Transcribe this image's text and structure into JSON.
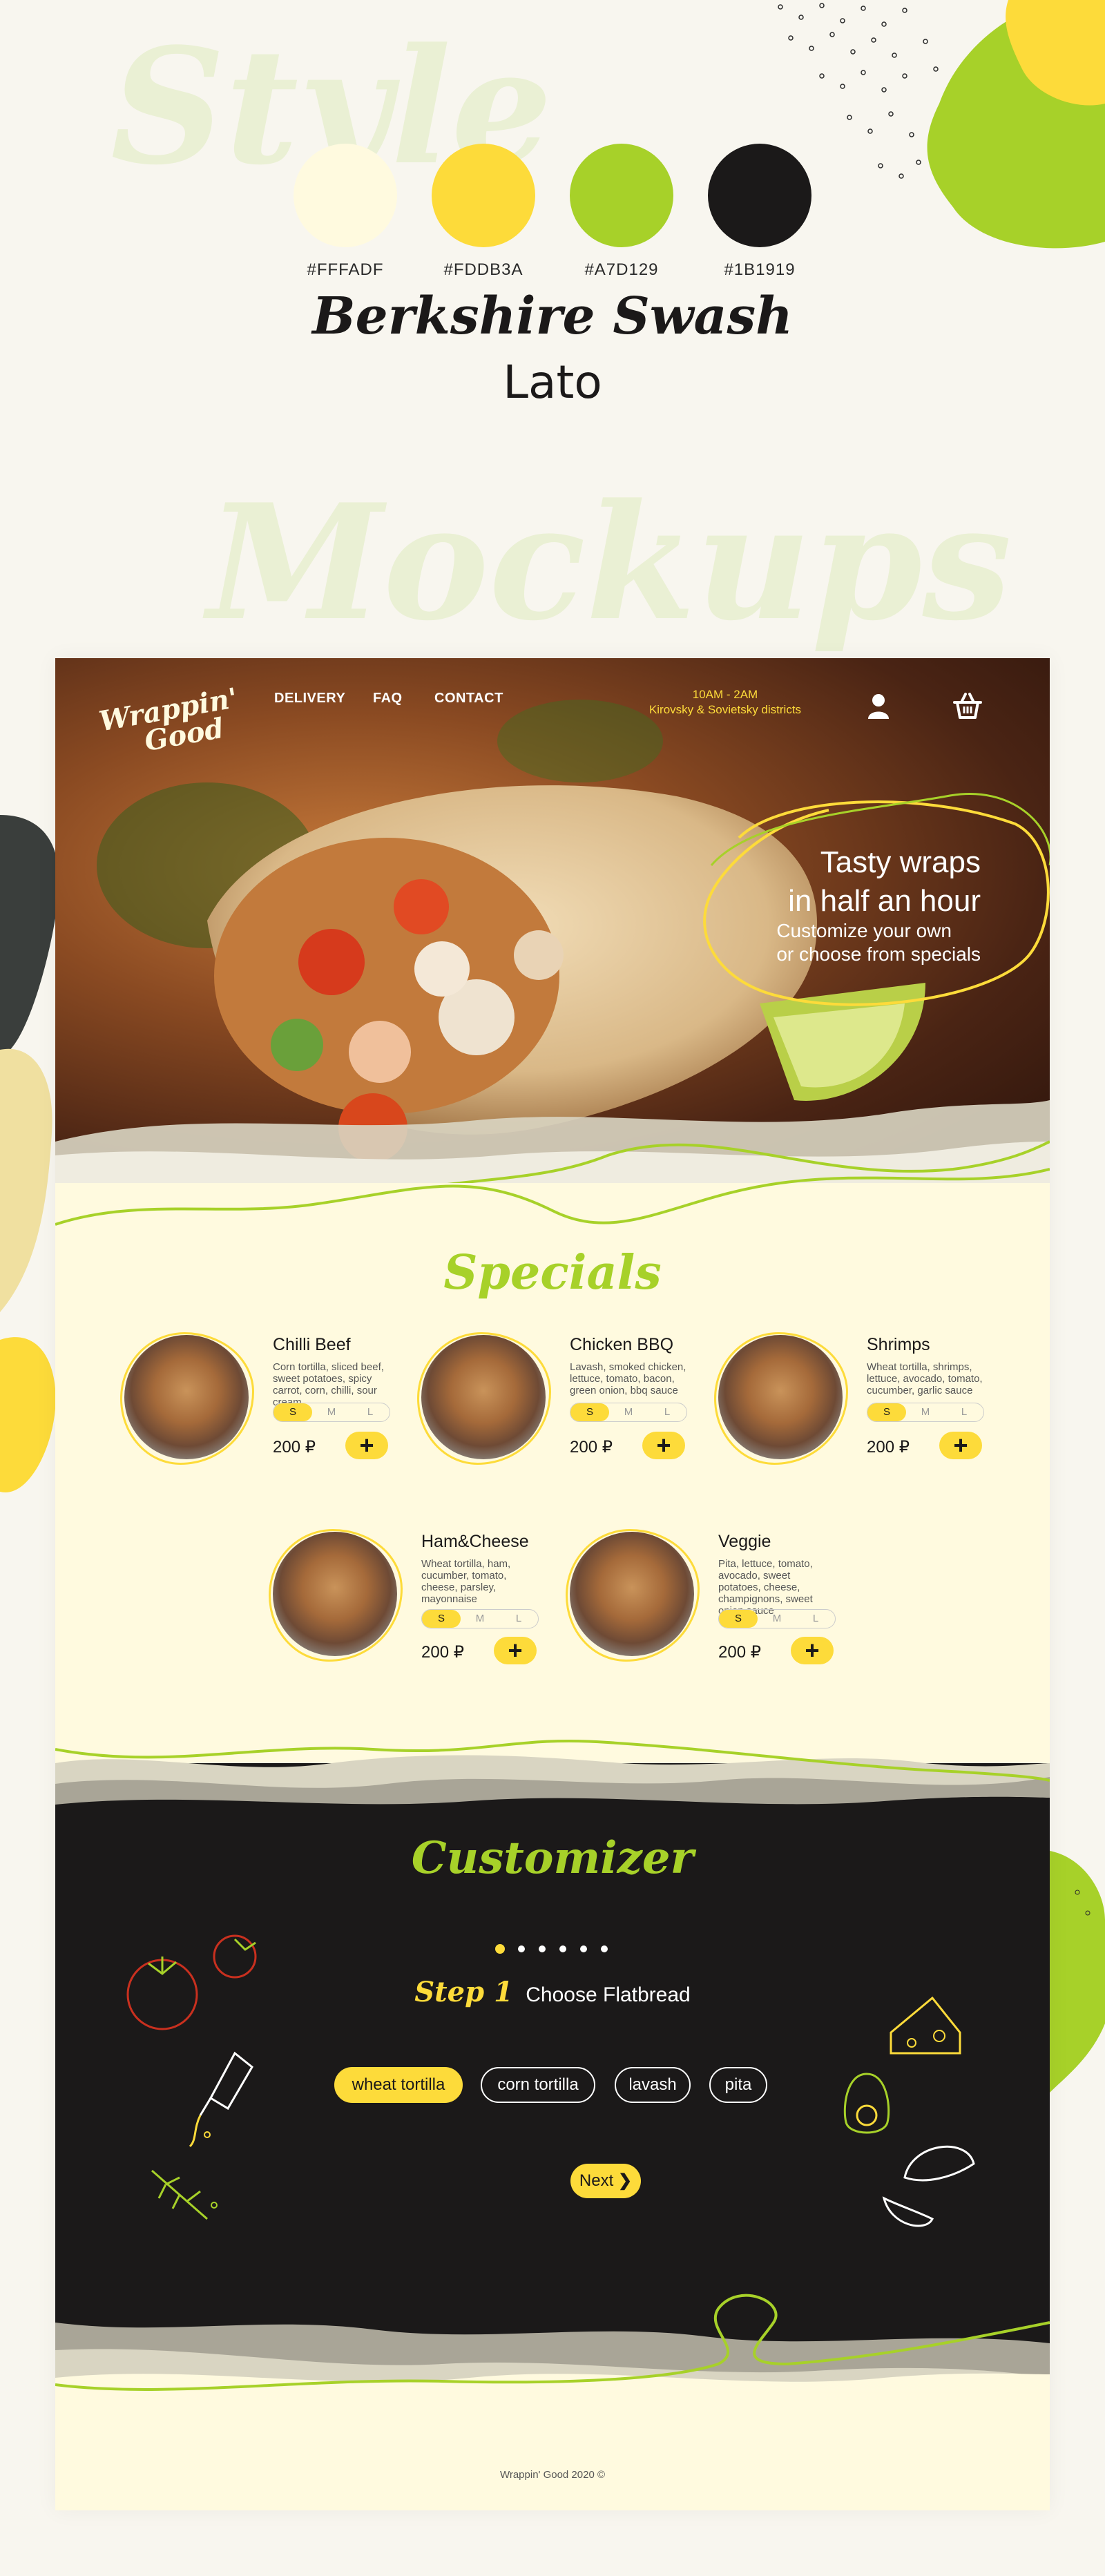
{
  "style_board": {
    "ghost_title": "Style",
    "colors": [
      {
        "hex": "#FFFADF",
        "label": "#FFFADF"
      },
      {
        "hex": "#FDDB3A",
        "label": "#FDDB3A"
      },
      {
        "hex": "#A7D129",
        "label": "#A7D129"
      },
      {
        "hex": "#1B1919",
        "label": "#1B1919"
      }
    ],
    "font_display": "Berkshire Swash",
    "font_body": "Lato",
    "ghost_mockups": "Mockups"
  },
  "header": {
    "logo_line1": "Wrappin'",
    "logo_line2": "Good",
    "nav": [
      "DELIVERY",
      "FAQ",
      "CONTACT"
    ],
    "hours": "10AM - 2AM",
    "districts": "Kirovsky & Sovietsky districts",
    "user_icon": "user-icon",
    "cart_icon": "basket-icon"
  },
  "hero": {
    "title_line1": "Tasty wraps",
    "title_line2": "in half an hour",
    "subtitle_line1": "Customize your own",
    "subtitle_line2": "or choose from specials"
  },
  "specials": {
    "title": "Specials",
    "sizes": [
      "S",
      "M",
      "L"
    ],
    "add_label": "+",
    "items": [
      {
        "name": "Chilli Beef",
        "desc": "Corn tortilla, sliced beef, sweet potatoes, spicy carrot, corn, chilli, sour cream",
        "price": "200 ₽"
      },
      {
        "name": "Chicken BBQ",
        "desc": "Lavash, smoked chicken, lettuce, tomato, bacon, green onion, bbq sauce",
        "price": "200 ₽"
      },
      {
        "name": "Shrimps",
        "desc": "Wheat tortilla, shrimps, lettuce, avocado, tomato, cucumber, garlic sauce",
        "price": "200 ₽"
      },
      {
        "name": "Ham&Cheese",
        "desc": "Wheat tortilla, ham, cucumber, tomato, cheese, parsley, mayonnaise",
        "price": "200 ₽"
      },
      {
        "name": "Veggie",
        "desc": "Pita, lettuce, tomato, avocado, sweet potatoes, cheese, champignons, sweet onion sauce",
        "price": "200 ₽"
      }
    ]
  },
  "customizer": {
    "title": "Customizer",
    "step_label": "Step 1",
    "step_text": "Choose Flatbread",
    "steps_total": 6,
    "current_step": 1,
    "options": [
      "wheat tortilla",
      "corn tortilla",
      "lavash",
      "pita"
    ],
    "selected": "wheat tortilla",
    "next_label": "Next"
  },
  "footer": {
    "text": "Wrappin' Good 2020 ©"
  }
}
